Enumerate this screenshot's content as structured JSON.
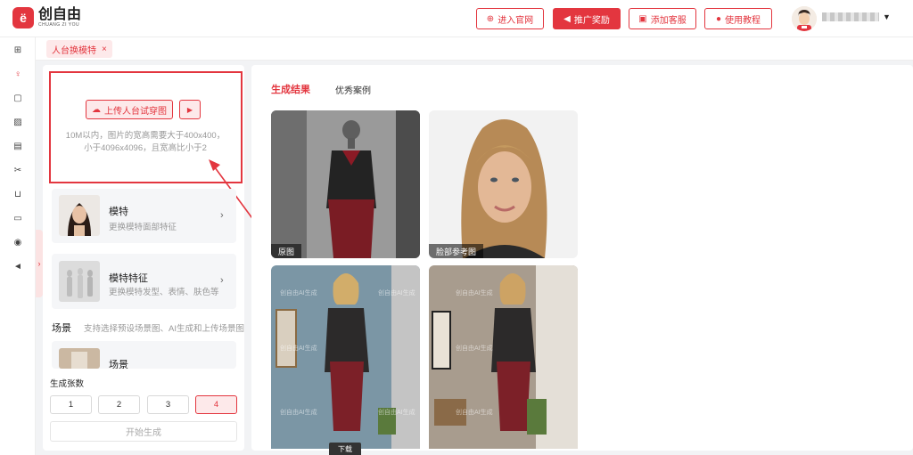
{
  "app": {
    "logo_mark": "ë",
    "name": "创自由",
    "name_en": "CHUANG ZI YOU"
  },
  "header": {
    "buttons": [
      {
        "label": "进入官网",
        "icon": "globe-icon"
      },
      {
        "label": "推广奖励",
        "icon": "megaphone-icon"
      },
      {
        "label": "添加客服",
        "icon": "gift-icon"
      },
      {
        "label": "使用教程",
        "icon": "play-circle-icon"
      }
    ]
  },
  "tabs": [
    {
      "label": "人台换模特",
      "close": "×"
    }
  ],
  "upload": {
    "button_label": "上传人台试穿图",
    "hint_line1": "10M以内，图片的宽高需要大于400x400，",
    "hint_line2": "小于4096x4096，且宽高比小于2"
  },
  "cards": [
    {
      "title": "模特",
      "subtitle": "更换模特面部特征"
    },
    {
      "title": "模特特征",
      "subtitle": "更换模特发型、表情、肤色等"
    },
    {
      "title": "场景",
      "subtitle": ""
    }
  ],
  "scene": {
    "label": "场景",
    "description": "支持选择预设场景图、AI生成和上传场景图"
  },
  "count": {
    "label": "生成张数",
    "options": [
      "1",
      "2",
      "3",
      "4"
    ],
    "selected": "4"
  },
  "generate_label": "开始生成",
  "results": {
    "tabs": [
      "生成结果",
      "优秀案例"
    ],
    "active_tab": "生成结果",
    "captions": [
      "原图",
      "脸部参考图"
    ],
    "watermark": "创自由AI生成",
    "download_label": "下载"
  },
  "colors": {
    "accent": "#e3363f",
    "accent_light": "#fde9ea"
  }
}
